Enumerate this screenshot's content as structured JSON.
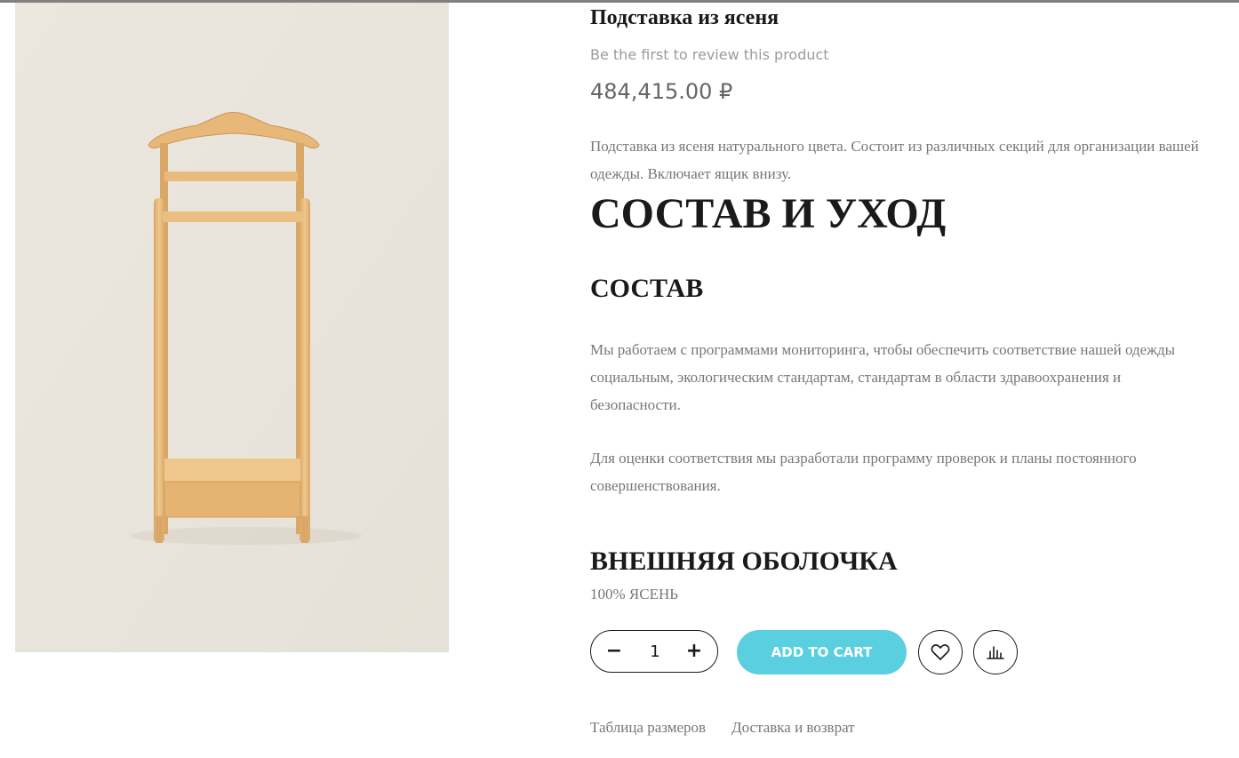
{
  "product": {
    "title": "Подставка из ясеня",
    "review_text": "Be the first to review this product",
    "price": "484,415.00 ₽",
    "description": "Подставка из ясеня натурального цвета. Состоит из различных секций для организации вашей одежды. Включает ящик внизу."
  },
  "details": {
    "heading": "СОСТАВ И УХОД",
    "composition_heading": "СОСТАВ",
    "composition_text_1": "Мы работаем с программами мониторинга, чтобы обеспечить соответствие нашей одежды социальным, экологическим стандартам, стандартам в области здравоохранения и безопасности.",
    "composition_text_2": "Для оценки соответствия мы разработали программу проверок и планы постоянного совершенствования.",
    "outer_heading": "ВНЕШНЯЯ ОБОЛОЧКА",
    "outer_material": "100% ЯСЕНЬ"
  },
  "cart": {
    "minus_label": "−",
    "quantity": "1",
    "plus_label": "+",
    "add_to_cart_label": "Add to cart",
    "accent_color": "#5acfdf"
  },
  "icons": {
    "wishlist": "heart-icon",
    "compare": "bar-chart-icon"
  },
  "links": {
    "size_chart": "Таблица размеров",
    "delivery": "Доставка и возврат"
  }
}
